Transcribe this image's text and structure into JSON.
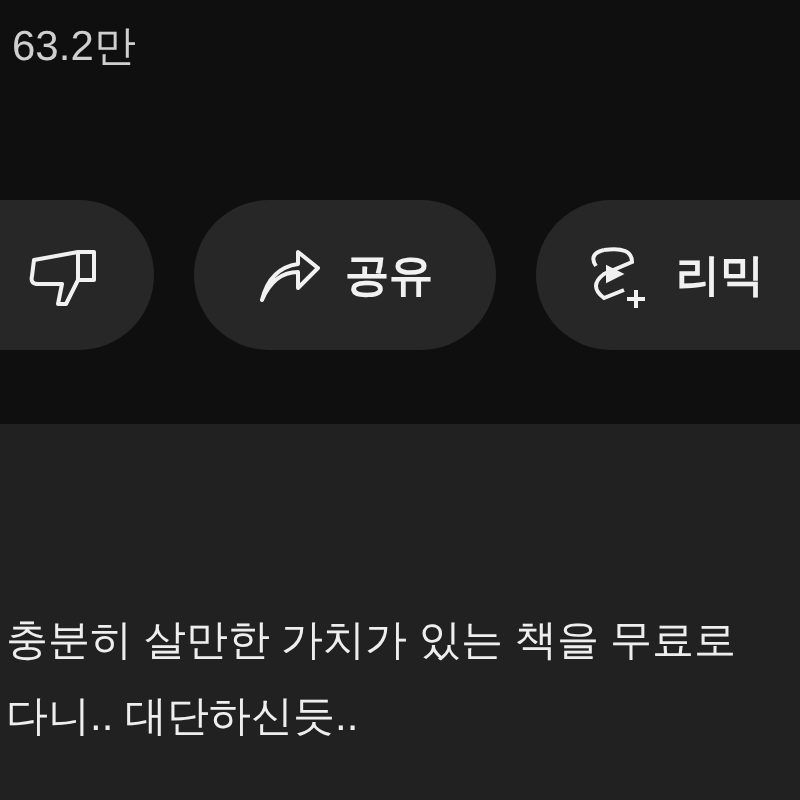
{
  "view_count": "63.2만",
  "actions": [
    {
      "kind": "dislike"
    },
    {
      "kind": "share",
      "label": "공유"
    },
    {
      "kind": "remix",
      "label": "리믹"
    }
  ],
  "comment": {
    "lines": [
      "충분히 살만한 가치가 있는 책을 무료로",
      "다니.. 대단하신듯.."
    ]
  }
}
